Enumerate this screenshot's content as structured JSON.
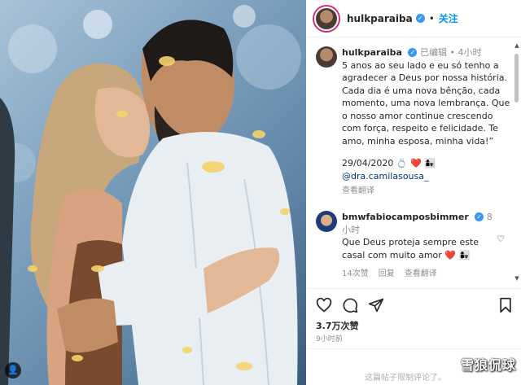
{
  "photo": {
    "tag_label": "👤"
  },
  "header": {
    "username": "hulkparaiba",
    "separator": "•",
    "follow_label": "关注"
  },
  "caption": {
    "username": "hulkparaiba",
    "edited_label": "已编辑",
    "time_ago": "4小时",
    "text": "5 anos ao seu lado e eu só tenho a agradecer a Deus por nossa história. Cada dia é uma nova bênção, cada momento, uma nova lembrança. Que o nosso amor continue crescendo com força, respeito e felicidade. Te amo, minha esposa, minha vida!”",
    "date_line": "29/04/2020",
    "emoji_ring": "💍",
    "emoji_heart": "❤️",
    "emoji_people": "👩‍👧",
    "mention": "@dra.camilasousa_",
    "translate_label": "查看翻译"
  },
  "comment": {
    "username": "bmwfabiocampos",
    "username_rest": "bimmer",
    "time_ago": "8小时",
    "text": "Que Deus proteja sempre este casal com muito amor",
    "emoji_heart": "❤️",
    "emoji_people": "👩‍👧",
    "likes_label": "14次赞",
    "reply_label": "回复",
    "translate_label": "查看翻译"
  },
  "post": {
    "likes_text": "3.7万次赞",
    "time_text": "9小时前",
    "restricted_text": "这篇帖子限制评论了。"
  },
  "watermark": "雪狼侃球",
  "colors": {
    "accent": "#0095f6",
    "verified": "#3897f0",
    "heart": "#ed4956",
    "muted": "#8e8e8e"
  }
}
